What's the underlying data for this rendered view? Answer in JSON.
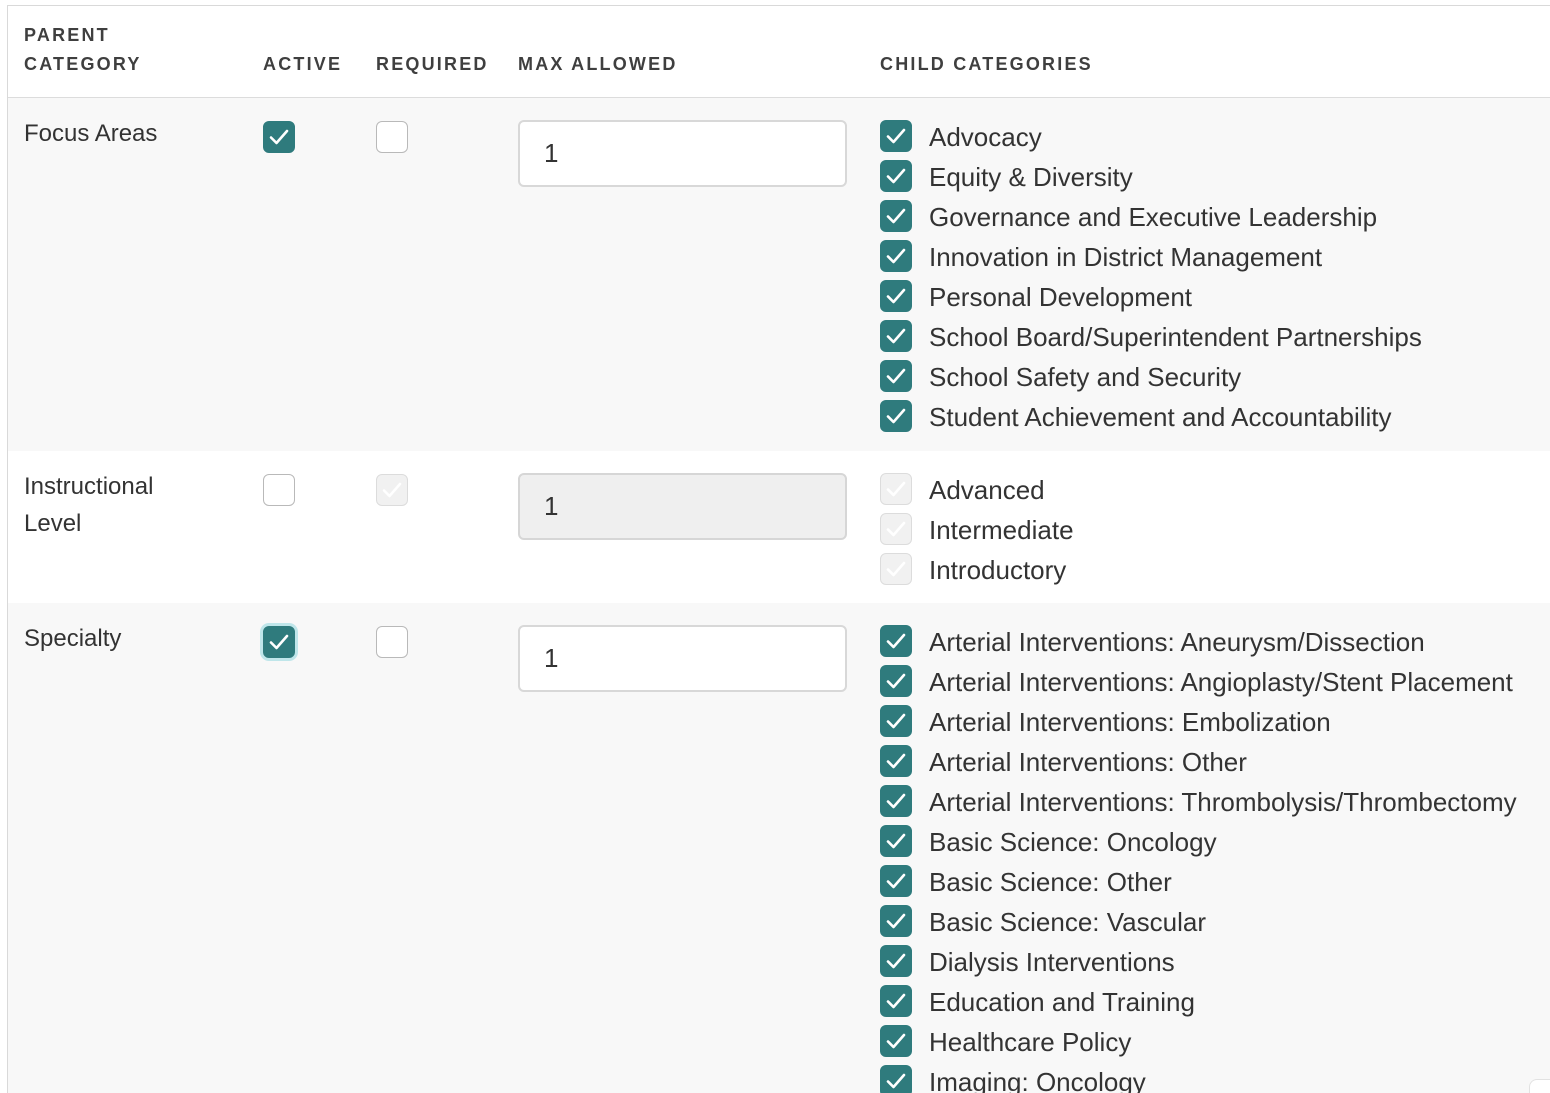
{
  "table": {
    "headers": {
      "parent_category": "PARENT CATEGORY",
      "active": "ACTIVE",
      "required": "REQUIRED",
      "max_allowed": "MAX ALLOWED",
      "child_categories": "CHILD CATEGORIES"
    },
    "rows": [
      {
        "name": "Focus Areas",
        "active": true,
        "required": false,
        "max_allowed": "1",
        "disabled": false,
        "children": [
          {
            "label": "Advocacy",
            "checked": true
          },
          {
            "label": "Equity & Diversity",
            "checked": true
          },
          {
            "label": "Governance and Executive Leadership",
            "checked": true
          },
          {
            "label": "Innovation in District Management",
            "checked": true
          },
          {
            "label": "Personal Development",
            "checked": true
          },
          {
            "label": "School Board/Superintendent Partnerships",
            "checked": true
          },
          {
            "label": "School Safety and Security",
            "checked": true
          },
          {
            "label": "Student Achievement and Accountability",
            "checked": true
          }
        ]
      },
      {
        "name": "Instructional Level",
        "active": false,
        "required": true,
        "max_allowed": "1",
        "disabled": true,
        "children": [
          {
            "label": "Advanced",
            "checked": true
          },
          {
            "label": "Intermediate",
            "checked": true
          },
          {
            "label": "Introductory",
            "checked": true
          }
        ]
      },
      {
        "name": "Specialty",
        "active": true,
        "required": false,
        "max_allowed": "1",
        "disabled": false,
        "children": [
          {
            "label": "Arterial Interventions: Aneurysm/Dissection",
            "checked": true
          },
          {
            "label": "Arterial Interventions: Angioplasty/Stent Placement",
            "checked": true
          },
          {
            "label": "Arterial Interventions: Embolization",
            "checked": true
          },
          {
            "label": "Arterial Interventions: Other",
            "checked": true
          },
          {
            "label": "Arterial Interventions: Thrombolysis/Thrombectomy",
            "checked": true
          },
          {
            "label": "Basic Science: Oncology",
            "checked": true
          },
          {
            "label": "Basic Science: Other",
            "checked": true
          },
          {
            "label": "Basic Science: Vascular",
            "checked": true
          },
          {
            "label": "Dialysis Interventions",
            "checked": true
          },
          {
            "label": "Education and Training",
            "checked": true
          },
          {
            "label": "Healthcare Policy",
            "checked": true
          },
          {
            "label": "Imaging: Oncology",
            "checked": true
          }
        ]
      }
    ]
  },
  "colors": {
    "checked": "#2f7b7d",
    "disabled": "#f1f1f1",
    "row_alt": "#f8f8f8"
  },
  "icons": {
    "checkbox_check": "check-icon"
  }
}
